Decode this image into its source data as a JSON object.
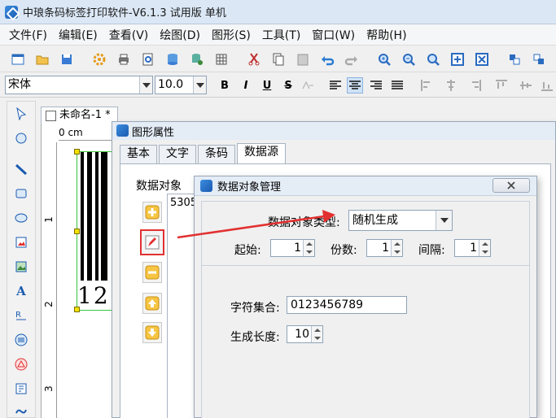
{
  "window": {
    "title": "中琅条码标签打印软件-V6.1.3 试用版 单机"
  },
  "menu": [
    {
      "label": "文件(F)"
    },
    {
      "label": "编辑(E)"
    },
    {
      "label": "查看(V)"
    },
    {
      "label": "绘图(D)"
    },
    {
      "label": "图形(S)"
    },
    {
      "label": "工具(T)"
    },
    {
      "label": "窗口(W)"
    },
    {
      "label": "帮助(H)"
    }
  ],
  "format_bar": {
    "font": "宋体",
    "size": "10.0",
    "bold": "B",
    "italic": "I",
    "underline": "U",
    "strike": "S"
  },
  "document": {
    "tab_label": "未命名-1 *",
    "ruler_top_label": "0 cm",
    "ruler_left_marks": [
      "1",
      "2",
      "3"
    ],
    "barcode_text": "12"
  },
  "shape_dialog": {
    "title": "图形属性",
    "tabs": [
      {
        "label": "基本"
      },
      {
        "label": "文字"
      },
      {
        "label": "条码"
      },
      {
        "label": "数据源"
      }
    ],
    "active_tab": "数据源",
    "section_label": "数据对象",
    "list_item": "5305"
  },
  "data_dialog": {
    "title": "数据对象管理",
    "type_label": "数据对象类型:",
    "type_value": "随机生成",
    "start_label": "起始:",
    "start_value": "1",
    "count_label": "份数:",
    "count_value": "1",
    "interval_label": "间隔:",
    "interval_value": "1",
    "charset_label": "字符集合:",
    "charset_value": "0123456789",
    "length_label": "生成长度:",
    "length_value": "10"
  },
  "colors": {
    "accent_red": "#e23030",
    "titlebar": "#dbe7f5",
    "selection_green": "#3ac53a"
  }
}
